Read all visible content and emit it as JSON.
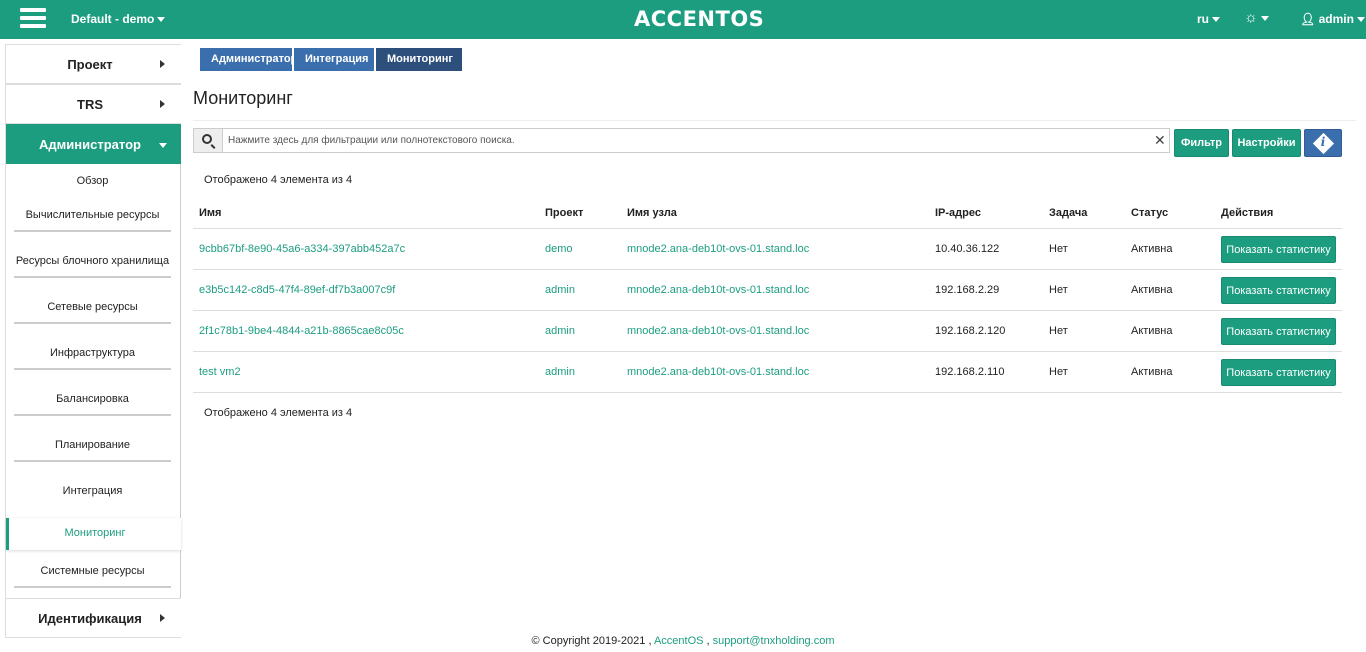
{
  "header": {
    "project": "Default - demo",
    "logo": "ACCENTOS",
    "language": "ru",
    "settings_icon": "gear-icon",
    "user": "admin",
    "brand_color": "#1c9d80"
  },
  "sidebar": {
    "sections": {
      "project": "Проект",
      "trs": "TRS",
      "admin": "Администратор",
      "identity": "Идентификация"
    },
    "admin_items": [
      "Обзор",
      "Вычислительные ресурсы",
      "Ресурсы блочного хранилища",
      "Сетевые ресурсы",
      "Инфраструктура",
      "Балансировка",
      "Планирование",
      "Интеграция",
      "Мониторинг",
      "Системные ресурсы"
    ]
  },
  "breadcrumb": [
    "Администратор",
    "Интеграция",
    "Мониторинг"
  ],
  "page": {
    "title": "Мониторинг",
    "search_placeholder": "Нажмите здесь для фильтрации или полнотекстового поиска.",
    "filter_label": "Фильтр",
    "settings_label": "Настройки",
    "count_text": "Отображено 4 элемента из 4"
  },
  "table": {
    "columns": [
      "Имя",
      "Проект",
      "Имя узла",
      "IP-адрес",
      "Задача",
      "Статус",
      "Действия"
    ],
    "rows": [
      {
        "name": "9cbb67bf-8e90-45a6-a334-397abb452a7c",
        "project": "demo",
        "host": "mnode2.ana-deb10t-ovs-01.stand.loc",
        "ip": "10.40.36.122",
        "task": "Нет",
        "status": "Активна",
        "action": "Показать статистику"
      },
      {
        "name": "e3b5c142-c8d5-47f4-89ef-df7b3a007c9f",
        "project": "admin",
        "host": "mnode2.ana-deb10t-ovs-01.stand.loc",
        "ip": "192.168.2.29",
        "task": "Нет",
        "status": "Активна",
        "action": "Показать статистику"
      },
      {
        "name": "2f1c78b1-9be4-4844-a21b-8865cae8c05c",
        "project": "admin",
        "host": "mnode2.ana-deb10t-ovs-01.stand.loc",
        "ip": "192.168.2.120",
        "task": "Нет",
        "status": "Активна",
        "action": "Показать статистику"
      },
      {
        "name": "test vm2",
        "project": "admin",
        "host": "mnode2.ana-deb10t-ovs-01.stand.loc",
        "ip": "192.168.2.110",
        "task": "Нет",
        "status": "Активна",
        "action": "Показать статистику"
      }
    ]
  },
  "footer": {
    "copyright": "© Copyright 2019-2021 ,",
    "product": "AccentOS",
    "separator": ",",
    "email": "support@tnxholding.com"
  }
}
